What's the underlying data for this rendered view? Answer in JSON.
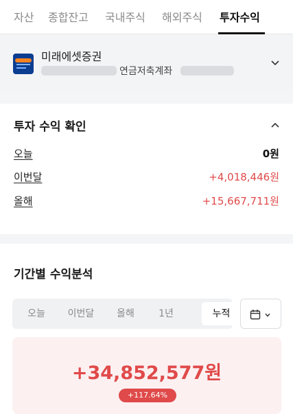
{
  "tabs": [
    {
      "label": "자산"
    },
    {
      "label": "종합잔고"
    },
    {
      "label": "국내주식"
    },
    {
      "label": "해외주식"
    },
    {
      "label": "투자수익",
      "active": true
    }
  ],
  "account": {
    "broker": "미래에셋증권",
    "type": "연금저축계좌",
    "logo_text": "MIRAE ASSET"
  },
  "profit": {
    "title": "투자 수익 확인",
    "rows": [
      {
        "label": "오늘",
        "value": "0원"
      },
      {
        "label": "이번달",
        "value": "+4,018,446원"
      },
      {
        "label": "올해",
        "value": "+15,667,711원"
      }
    ]
  },
  "analysis": {
    "title": "기간별 수익분석",
    "periods": [
      {
        "label": "오늘"
      },
      {
        "label": "이번달"
      },
      {
        "label": "올해"
      },
      {
        "label": "1년"
      },
      {
        "label": "누적",
        "active": true
      }
    ],
    "amount": "+34,852,577원",
    "rate": "+117.64%"
  },
  "colors": {
    "accent_red": "#e04a4a",
    "brand_blue": "#0b3d91",
    "brand_orange": "#f58220"
  }
}
